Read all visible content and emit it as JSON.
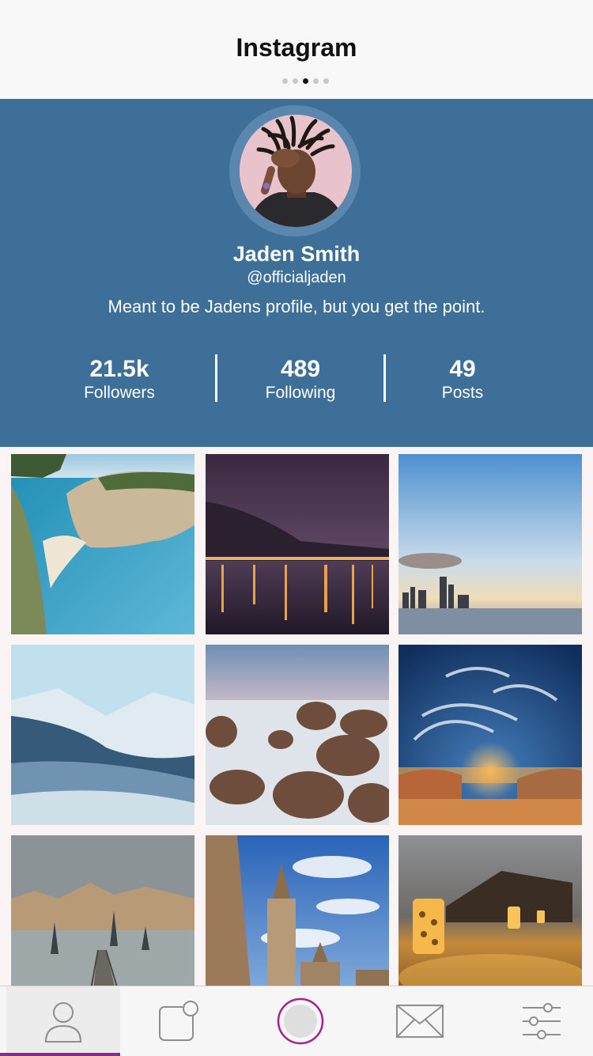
{
  "header": {
    "title": "Instagram",
    "page_dots": 5,
    "active_dot": 2
  },
  "profile": {
    "name": "Jaden Smith",
    "handle": "@officialjaden",
    "bio": "Meant to be Jadens profile, but you get the point.",
    "stats": [
      {
        "value": "21.5k",
        "label": "Followers"
      },
      {
        "value": "489",
        "label": "Following"
      },
      {
        "value": "49",
        "label": "Posts"
      }
    ]
  },
  "colors": {
    "profile_bg": "#3d6f99",
    "accent": "#8a2a8d",
    "page_bg": "#fbf4f4"
  },
  "grid": [
    {
      "subject": "cliff-beach-photo"
    },
    {
      "subject": "night-harbor-photo"
    },
    {
      "subject": "city-skyline-photo"
    },
    {
      "subject": "snowy-mountains-photo"
    },
    {
      "subject": "rocky-coast-photo"
    },
    {
      "subject": "sunset-sky-photo"
    },
    {
      "subject": "foggy-mountain-bridge-photo"
    },
    {
      "subject": "cathedral-tower-photo"
    },
    {
      "subject": "desert-lanterns-photo"
    }
  ],
  "tabbar": {
    "items": [
      "profile-tab",
      "notifications-tab",
      "camera-tab",
      "messages-tab",
      "settings-tab"
    ],
    "active": "profile-tab"
  }
}
